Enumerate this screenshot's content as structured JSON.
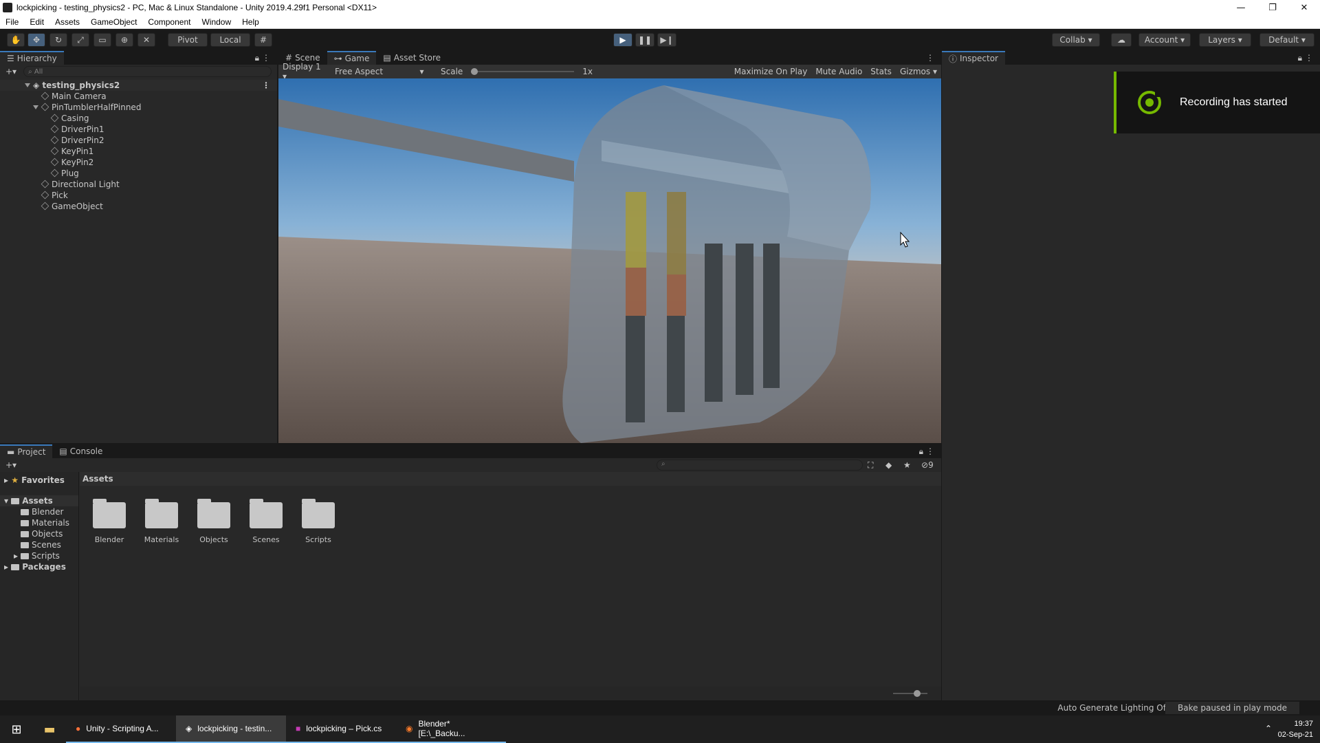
{
  "window": {
    "title": "lockpicking - testing_physics2 - PC, Mac & Linux Standalone - Unity 2019.4.29f1 Personal <DX11>",
    "minimize": "—",
    "restore": "❐",
    "close": "✕"
  },
  "menu": [
    "File",
    "Edit",
    "Assets",
    "GameObject",
    "Component",
    "Window",
    "Help"
  ],
  "toolbar": {
    "pivot": "Pivot",
    "local": "Local",
    "collab": "Collab",
    "account": "Account",
    "layers": "Layers",
    "layout": "Default"
  },
  "hierarchy": {
    "tab": "Hierarchy",
    "search_placeholder": "All",
    "scene": "testing_physics2",
    "items": [
      {
        "label": "Main Camera"
      },
      {
        "label": "PinTumblerHalfPinned"
      },
      {
        "label": "Casing"
      },
      {
        "label": "DriverPin1"
      },
      {
        "label": "DriverPin2"
      },
      {
        "label": "KeyPin1"
      },
      {
        "label": "KeyPin2"
      },
      {
        "label": "Plug"
      },
      {
        "label": "Directional Light"
      },
      {
        "label": "Pick"
      },
      {
        "label": "GameObject"
      }
    ]
  },
  "gameview": {
    "tabs": [
      "Scene",
      "Game",
      "Asset Store"
    ],
    "display": "Display 1",
    "aspect": "Free Aspect",
    "scale_label": "Scale",
    "scale_value": "1x",
    "maximize": "Maximize On Play",
    "mute": "Mute Audio",
    "stats": "Stats",
    "gizmos": "Gizmos"
  },
  "inspector": {
    "tab": "Inspector"
  },
  "notification": {
    "text": "Recording has started",
    "accent": "#76b900"
  },
  "project": {
    "tabs": [
      "Project",
      "Console"
    ],
    "breadcrumb": "Assets",
    "favorites": "Favorites",
    "assets_root": "Assets",
    "tree": [
      "Blender",
      "Materials",
      "Objects",
      "Scenes",
      "Scripts"
    ],
    "packages": "Packages",
    "folders": [
      "Blender",
      "Materials",
      "Objects",
      "Scenes",
      "Scripts"
    ],
    "hidden_count": "9"
  },
  "status": {
    "lighting": "Auto Generate Lighting Off",
    "bake": "Bake paused in play mode"
  },
  "taskbar": {
    "items": [
      "Unity - Scripting A...",
      "lockpicking - testin...",
      "lockpicking – Pick.cs",
      "Blender* [E:\\_Backu..."
    ],
    "time": "19:37",
    "date": "02-Sep-21"
  },
  "colors": {
    "accent": "#3a79bb",
    "play": "#46607c"
  }
}
